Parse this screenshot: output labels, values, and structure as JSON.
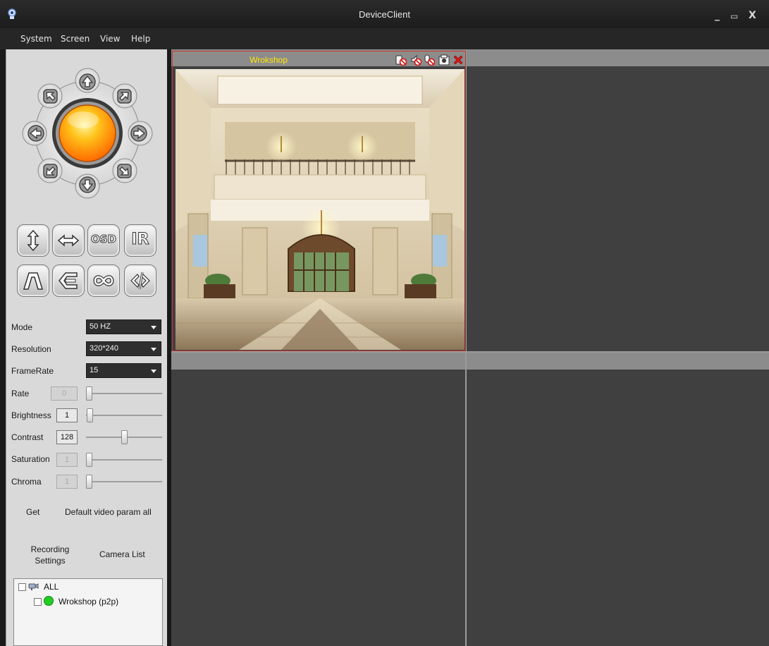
{
  "window": {
    "title": "DeviceClient",
    "min": "_",
    "max": "▭",
    "close": "X"
  },
  "menu": [
    "System",
    "Screen",
    "View",
    "Help"
  ],
  "controls": {
    "row1": [
      "vertical-flip",
      "horizontal-flip",
      "OSD",
      "IR"
    ],
    "row2": [
      "perspective",
      "mirror",
      "infinite-loop",
      "code"
    ],
    "osd_label": "OSD",
    "ir_label": "IR"
  },
  "params": {
    "mode": {
      "label": "Mode",
      "value": "50 HZ"
    },
    "resolution": {
      "label": "Resolution",
      "value": "320*240"
    },
    "framerate": {
      "label": "FrameRate",
      "value": "15"
    },
    "rate": {
      "label": "Rate",
      "value": "0",
      "level": 0
    },
    "brightness": {
      "label": "Brightness",
      "value": "1",
      "level": 0.01
    },
    "contrast": {
      "label": "Contrast",
      "value": "128",
      "level": 0.5
    },
    "saturation": {
      "label": "Saturation",
      "value": "1",
      "level": 0.0
    },
    "chroma": {
      "label": "Chroma",
      "value": "1",
      "level": 0.0
    }
  },
  "actions": {
    "get": "Get",
    "default": "Default video param all",
    "recording_line1": "Recording",
    "recording_line2": "Settings",
    "camera_list": "Camera List"
  },
  "tree": {
    "root": "ALL",
    "items": [
      {
        "label": "Wrokshop (p2p)",
        "status": "online",
        "status_color": "#22cc22"
      }
    ]
  },
  "camera": {
    "title": "Wrokshop",
    "title_color": "#ffe600",
    "frame_color": "#c8342b"
  },
  "colors": {
    "accent_ptz": "#ffb300",
    "panel_bg": "#d9d9d9",
    "video_bg": "#404040"
  }
}
